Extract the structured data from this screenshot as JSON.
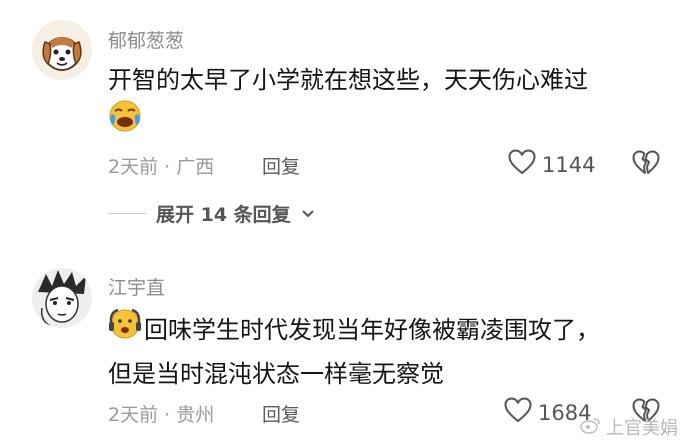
{
  "comments": [
    {
      "username": "郁郁葱葱",
      "text_line1": "开智的太早了小学就在想这些，天天伤心难过",
      "emoji_name": "crying-laughing-emoji",
      "time": "2天前",
      "separator": "·",
      "location": "广西",
      "reply_label": "回复",
      "like_count": "1144",
      "expand_label": "展开 14 条回复"
    },
    {
      "username": "江宇直",
      "emoji_name": "shocked-face-emoji",
      "text_line1": "回味学生时代发现当年好像被霸凌围攻了，",
      "text_line2": "但是当时混沌状态一样毫无察觉",
      "time": "2天前",
      "separator": "·",
      "location": "贵州",
      "reply_label": "回复",
      "like_count": "1684"
    }
  ],
  "watermark": "上官美娟",
  "colors": {
    "meta_gray": "#9a9a9a",
    "username_gray": "#8c8c8c",
    "text_dark": "#151515"
  }
}
